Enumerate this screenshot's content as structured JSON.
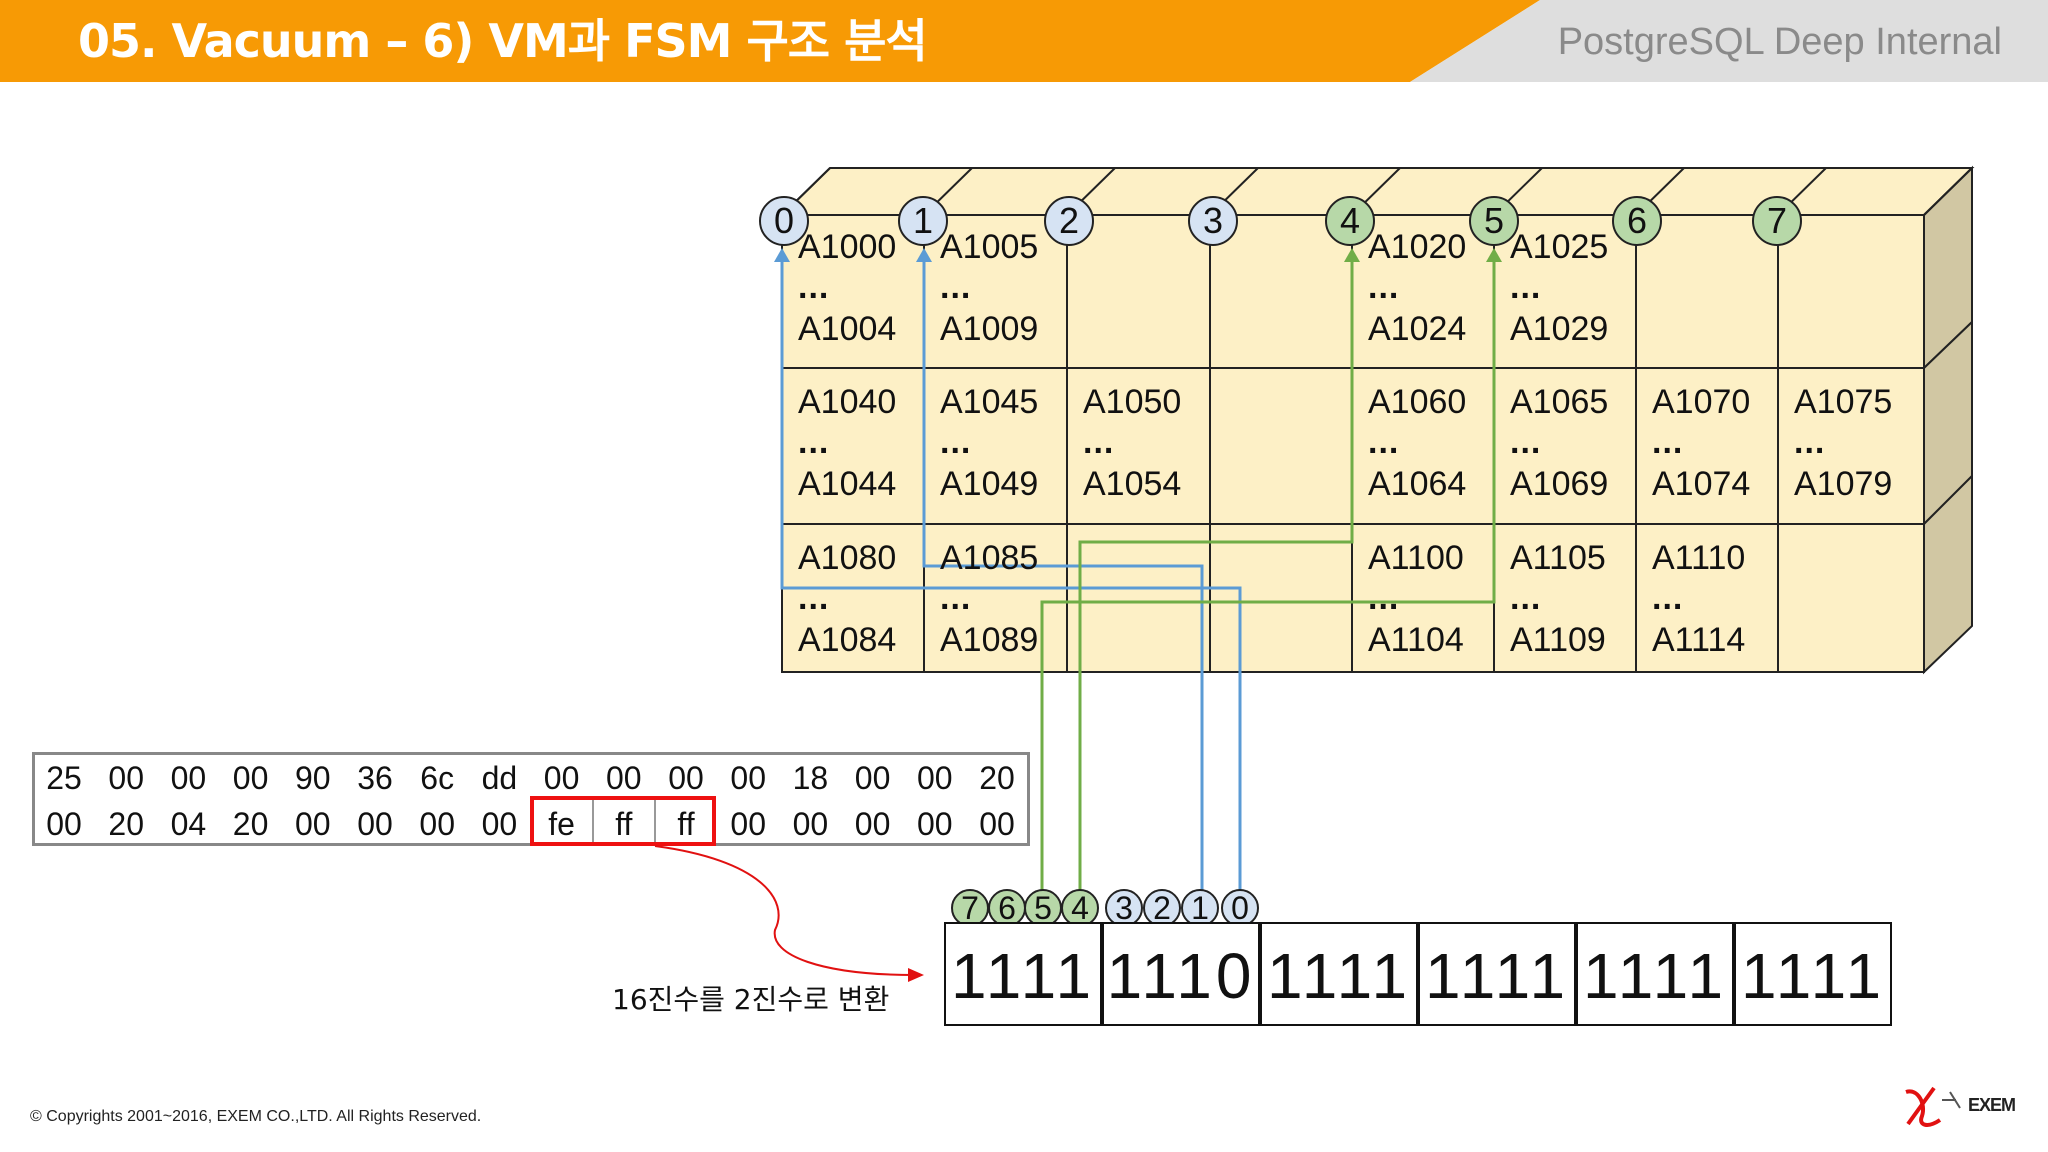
{
  "header": {
    "title": "05. Vacuum – 6) VM과 FSM 구조 분석",
    "subtitle": "PostgreSQL Deep Internal",
    "bar_color": "#F79A05",
    "right_color": "#DEDEDE"
  },
  "table": {
    "column_markers": [
      "0",
      "1",
      "2",
      "3",
      "4",
      "5",
      "6",
      "7"
    ],
    "marker_colors": {
      "blue": "#D6E3F3",
      "green": "#B7D8A8"
    },
    "rows": [
      [
        {
          "top": "A1000",
          "dots": "...",
          "bottom": "A1004"
        },
        {
          "top": "A1005",
          "dots": "...",
          "bottom": "A1009"
        },
        {
          "top": "",
          "dots": "",
          "bottom": ""
        },
        {
          "top": "",
          "dots": "",
          "bottom": ""
        },
        {
          "top": "A1020",
          "dots": "...",
          "bottom": "A1024"
        },
        {
          "top": "A1025",
          "dots": "...",
          "bottom": "A1029"
        },
        {
          "top": "",
          "dots": "",
          "bottom": ""
        },
        {
          "top": "",
          "dots": "",
          "bottom": ""
        }
      ],
      [
        {
          "top": "A1040",
          "dots": "...",
          "bottom": "A1044"
        },
        {
          "top": "A1045",
          "dots": "...",
          "bottom": "A1049"
        },
        {
          "top": "A1050",
          "dots": "...",
          "bottom": "A1054"
        },
        {
          "top": "",
          "dots": "",
          "bottom": ""
        },
        {
          "top": "A1060",
          "dots": "...",
          "bottom": "A1064"
        },
        {
          "top": "A1065",
          "dots": "...",
          "bottom": "A1069"
        },
        {
          "top": "A1070",
          "dots": "...",
          "bottom": "A1074"
        },
        {
          "top": "A1075",
          "dots": "...",
          "bottom": "A1079"
        }
      ],
      [
        {
          "top": "A1080",
          "dots": "...",
          "bottom": "A1084"
        },
        {
          "top": "A1085",
          "dots": "...",
          "bottom": "A1089"
        },
        {
          "top": "",
          "dots": "",
          "bottom": ""
        },
        {
          "top": "",
          "dots": "",
          "bottom": ""
        },
        {
          "top": "A1100",
          "dots": "...",
          "bottom": "A1104"
        },
        {
          "top": "A1105",
          "dots": "...",
          "bottom": "A1109"
        },
        {
          "top": "A1110",
          "dots": "...",
          "bottom": "A1114"
        },
        {
          "top": "",
          "dots": "",
          "bottom": ""
        }
      ]
    ],
    "cell_color": "#FDF0C6"
  },
  "hex": {
    "row1": [
      "25",
      "00",
      "00",
      "00",
      "90",
      "36",
      "6c",
      "dd",
      "00",
      "00",
      "00",
      "00",
      "18",
      "00",
      "00",
      "20"
    ],
    "row2": [
      "00",
      "20",
      "04",
      "20",
      "00",
      "00",
      "00",
      "00",
      "fe",
      "ff",
      "ff",
      "00",
      "00",
      "00",
      "00",
      "00"
    ]
  },
  "bits": {
    "markers": [
      "7",
      "6",
      "5",
      "4",
      "3",
      "2",
      "1",
      "0"
    ],
    "groups": [
      "1111",
      "1110",
      "1111",
      "1111",
      "1111",
      "1111"
    ]
  },
  "caption": "16진수를 2진수로 변환",
  "footer": "© Copyrights 2001~2016, EXEM CO.,LTD. All Rights Reserved.",
  "logo_text": "EXEM",
  "line_colors": {
    "blue": "#5B9BD5",
    "green": "#70AD47",
    "red": "#E11111"
  }
}
